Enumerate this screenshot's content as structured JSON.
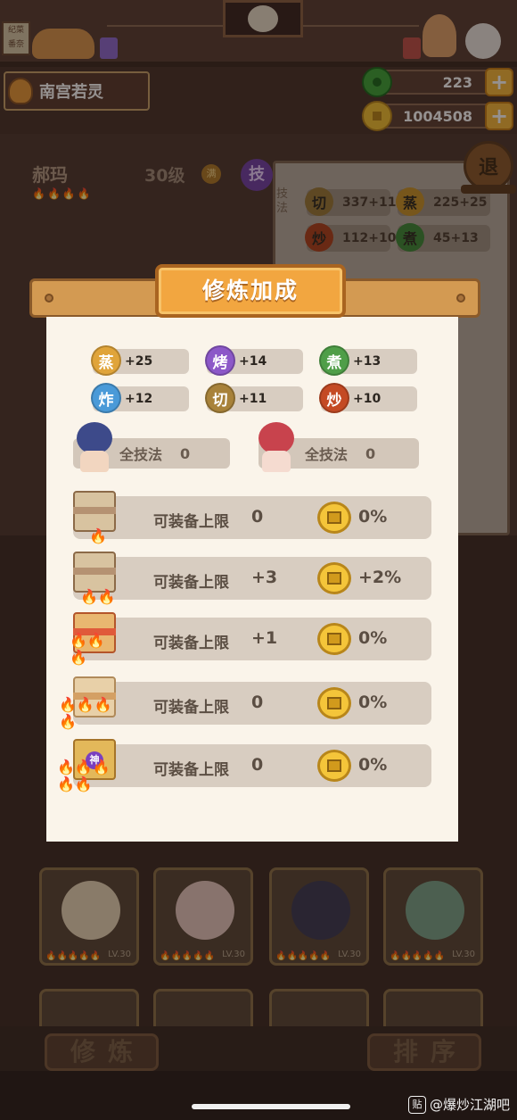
{
  "top_bar": {
    "sign_text": "纪菜 番奈"
  },
  "player": {
    "name": "南宫若灵"
  },
  "currencies": {
    "jade": "223",
    "coins": "1004508",
    "plus_label": "+"
  },
  "character": {
    "name": "郝玛",
    "level": "30级",
    "max_badge": "满",
    "skill_badge": "技",
    "flames": "🔥🔥🔥🔥"
  },
  "skills_panel": {
    "label": "技法",
    "chips": [
      {
        "name": "切",
        "value": "337+11",
        "color": "#9b7b3a"
      },
      {
        "name": "蒸",
        "value": "225+25",
        "color": "#c8942a"
      },
      {
        "name": "炒",
        "value": "112+10",
        "color": "#b0431e"
      },
      {
        "name": "煮",
        "value": "45+13",
        "color": "#3e8a39"
      }
    ]
  },
  "back_button": "退",
  "dialog": {
    "title": "修炼加成",
    "stats": [
      {
        "name": "蒸",
        "value": "+25",
        "color": "#e0a43a"
      },
      {
        "name": "烤",
        "value": "+14",
        "color": "#8c58c8"
      },
      {
        "name": "煮",
        "value": "+13",
        "color": "#4f9e48"
      },
      {
        "name": "炸",
        "value": "+12",
        "color": "#4a9ad8"
      },
      {
        "name": "切",
        "value": "+11",
        "color": "#a8823a"
      },
      {
        "name": "炒",
        "value": "+10",
        "color": "#c44a24"
      }
    ],
    "all_skills": [
      {
        "label": "全技法",
        "value": "0"
      },
      {
        "label": "全技法",
        "value": "0"
      }
    ],
    "equip_limits": [
      {
        "label": "可装备上限",
        "value": "0",
        "pct": "0%"
      },
      {
        "label": "可装备上限",
        "value": "+3",
        "pct": "+2%"
      },
      {
        "label": "可装备上限",
        "value": "+1",
        "pct": "0%"
      },
      {
        "label": "可装备上限",
        "value": "0",
        "pct": "0%"
      },
      {
        "label": "可装备上限",
        "value": "0",
        "pct": "0%"
      }
    ],
    "legendary_badge": "神"
  },
  "cards": {
    "level_label": "LV.30"
  },
  "bottom": {
    "train_button": "修炼",
    "sort_button": "排序"
  },
  "watermark": {
    "icon": "贴",
    "text": "@爆炒江湖吧"
  }
}
